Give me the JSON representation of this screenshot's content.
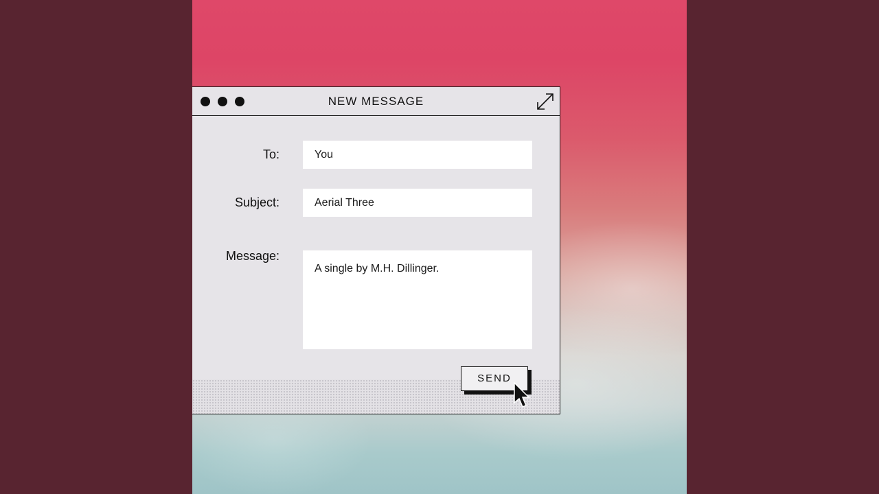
{
  "window": {
    "title": "NEW MESSAGE",
    "controls": [
      "close-dot",
      "minimize-dot",
      "zoom-dot"
    ],
    "expand_icon": "expand-arrow-icon"
  },
  "form": {
    "to": {
      "label": "To:",
      "value": "You"
    },
    "subject": {
      "label": "Subject:",
      "value": "Aerial Three"
    },
    "message": {
      "label": "Message:",
      "value": "A single by M.H. Dillinger."
    }
  },
  "actions": {
    "send_label": "SEND"
  },
  "colors": {
    "outer_background": "#582430",
    "window_background": "#e6e4e8",
    "field_background": "#ffffff",
    "text": "#111111"
  }
}
